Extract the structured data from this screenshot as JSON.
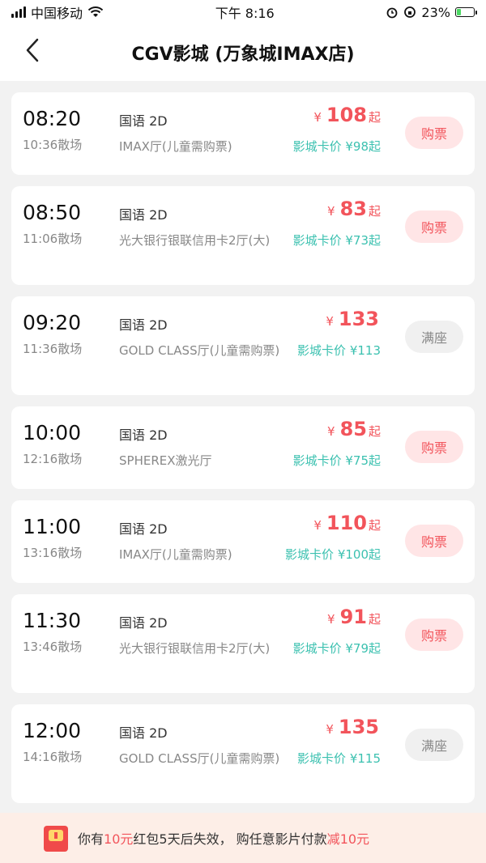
{
  "status_bar": {
    "carrier": "中国移动",
    "time": "下午 8:16",
    "battery": "23%",
    "battery_level": 0.23
  },
  "header": {
    "title": "CGV影城 (万象城IMAX店)"
  },
  "showtimes": [
    {
      "start": "08:20",
      "end": "10:36散场",
      "lang": "国语 2D",
      "hall": "IMAX厅(儿童需购票)",
      "yen": "¥",
      "price": "108",
      "suffix": "起",
      "card_price": "影城卡价 ¥98起",
      "button": "购票",
      "status": "buy"
    },
    {
      "start": "08:50",
      "end": "11:06散场",
      "lang": "国语 2D",
      "hall": "光大银行银联信用卡2厅(大)",
      "yen": "¥",
      "price": "83",
      "suffix": "起",
      "card_price": "影城卡价 ¥73起",
      "button": "购票",
      "status": "buy"
    },
    {
      "start": "09:20",
      "end": "11:36散场",
      "lang": "国语 2D",
      "hall": "GOLD CLASS厅(儿童需购票)",
      "yen": "¥",
      "price": "133",
      "suffix": "",
      "card_price": "影城卡价 ¥113",
      "button": "满座",
      "status": "full"
    },
    {
      "start": "10:00",
      "end": "12:16散场",
      "lang": "国语 2D",
      "hall": "SPHEREX激光厅",
      "yen": "¥",
      "price": "85",
      "suffix": "起",
      "card_price": "影城卡价 ¥75起",
      "button": "购票",
      "status": "buy"
    },
    {
      "start": "11:00",
      "end": "13:16散场",
      "lang": "国语 2D",
      "hall": "IMAX厅(儿童需购票)",
      "yen": "¥",
      "price": "110",
      "suffix": "起",
      "card_price": "影城卡价 ¥100起",
      "button": "购票",
      "status": "buy"
    },
    {
      "start": "11:30",
      "end": "13:46散场",
      "lang": "国语 2D",
      "hall": "光大银行银联信用卡2厅(大)",
      "yen": "¥",
      "price": "91",
      "suffix": "起",
      "card_price": "影城卡价 ¥79起",
      "button": "购票",
      "status": "buy"
    },
    {
      "start": "12:00",
      "end": "14:16散场",
      "lang": "国语 2D",
      "hall": "GOLD CLASS厅(儿童需购票)",
      "yen": "¥",
      "price": "135",
      "suffix": "",
      "card_price": "影城卡价 ¥115",
      "button": "满座",
      "status": "full"
    }
  ],
  "promo": {
    "part1": "你有",
    "amount1": "10元",
    "part2": "红包5天后失效， 购任意影片付款",
    "part3": "减",
    "amount2": "10元"
  },
  "colors": {
    "price_red": "#f2545b",
    "card_teal": "#3cc1b0",
    "buy_bg": "#ffe5e6",
    "full_bg": "#f0f0f0"
  }
}
